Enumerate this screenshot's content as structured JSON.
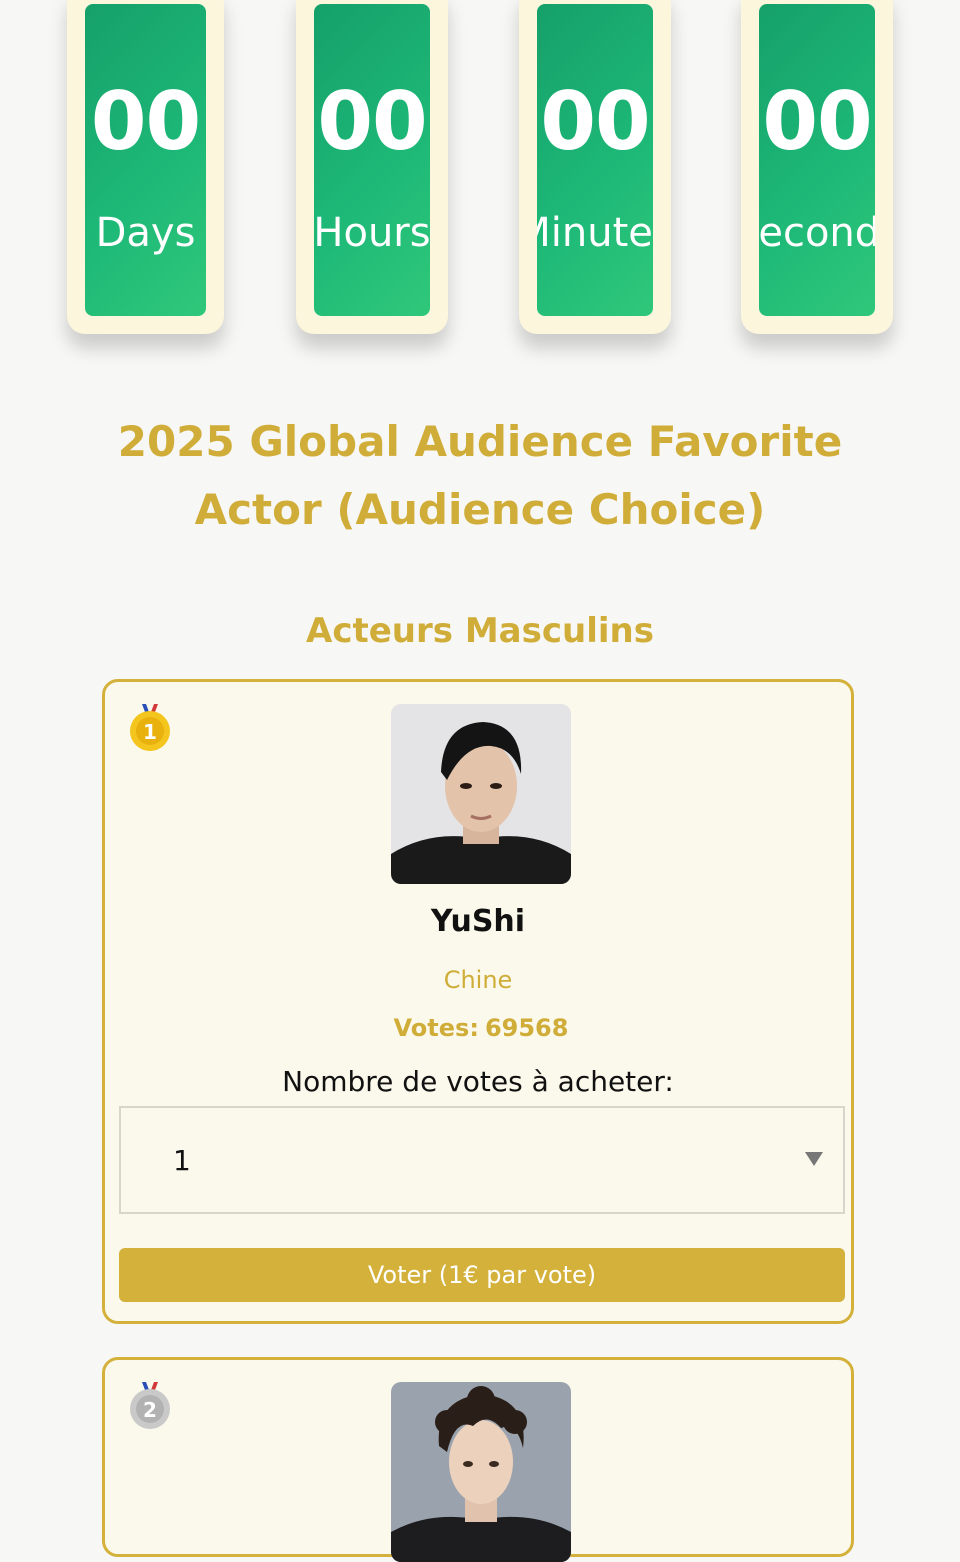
{
  "countdown": [
    {
      "value": "00",
      "label": "Days"
    },
    {
      "value": "00",
      "label": "Hours"
    },
    {
      "value": "00",
      "label": "Minutes"
    },
    {
      "value": "00",
      "label": "Seconds"
    }
  ],
  "title": "2025 Global Audience Favorite Actor (Audience Choice)",
  "section": "Acteurs Masculins",
  "actors": [
    {
      "rank": "1",
      "name": "YuShi",
      "country": "Chine",
      "votes_label": "Votes:",
      "votes": "69568",
      "buy_label": "Nombre de votes à acheter:",
      "select_value": "1",
      "button": "Voter (1€ par vote)"
    },
    {
      "rank": "2"
    }
  ],
  "colors": {
    "accent": "#d4b13a",
    "timer_green": "#1db877",
    "card_bg": "#fbf9ec"
  }
}
